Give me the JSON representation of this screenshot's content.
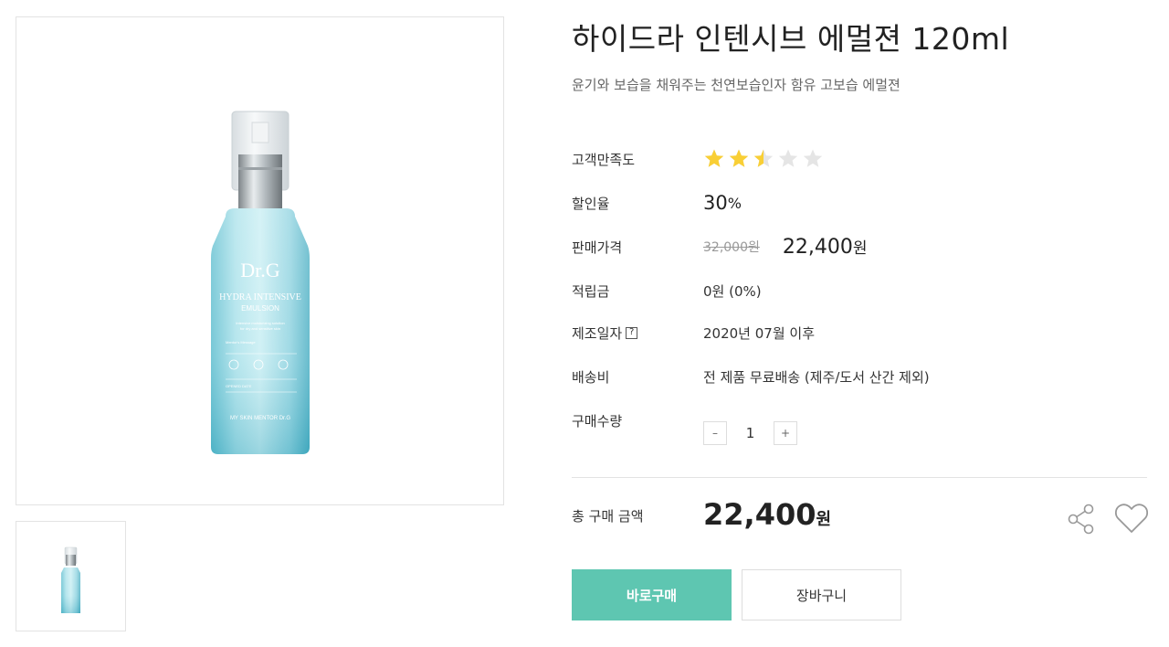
{
  "product": {
    "title": "하이드라 인텐시브 에멀젼 120ml",
    "subtitle": "윤기와 보습을 채워주는 천연보습인자 함유 고보습 에멀젼",
    "image": {
      "brand": "Dr.G",
      "name_line1": "HYDRA INTENSIVE",
      "name_line2": "EMULSION",
      "desc_line1": "Intensive moisturizing solution",
      "desc_line2": "for dry and sensitive skin",
      "message_label": "Mentor's Message",
      "opened_label": "OPENED DATE",
      "footer": "MY SKIN MENTOR Dr.G"
    }
  },
  "details": {
    "satisfaction": {
      "label": "고객만족도",
      "rating": 2.5,
      "max": 5
    },
    "discount": {
      "label": "할인율",
      "value": "30",
      "unit": "%"
    },
    "price": {
      "label": "판매가격",
      "original": "32,000원",
      "sale_value": "22,400",
      "sale_unit": "원"
    },
    "points": {
      "label": "적립금",
      "value": "0원 (0%)"
    },
    "manufacture": {
      "label": "제조일자",
      "help": "?",
      "value": "2020년 07월 이후"
    },
    "shipping": {
      "label": "배송비",
      "value": "전 제품 무료배송 (제주/도서 산간 제외)"
    },
    "quantity": {
      "label": "구매수량",
      "value": "1",
      "minus": "–",
      "plus": "+"
    }
  },
  "total": {
    "label": "총 구매 금액",
    "value": "22,400",
    "unit": "원"
  },
  "actions": {
    "buy": "바로구매",
    "cart": "장바구니"
  },
  "colors": {
    "accent": "#5ec6b1",
    "star": "#f9cf35",
    "star_empty": "#e5e5e5"
  },
  "icons": {
    "share": "share-icon",
    "wishlist": "heart-icon",
    "help": "help-icon"
  }
}
